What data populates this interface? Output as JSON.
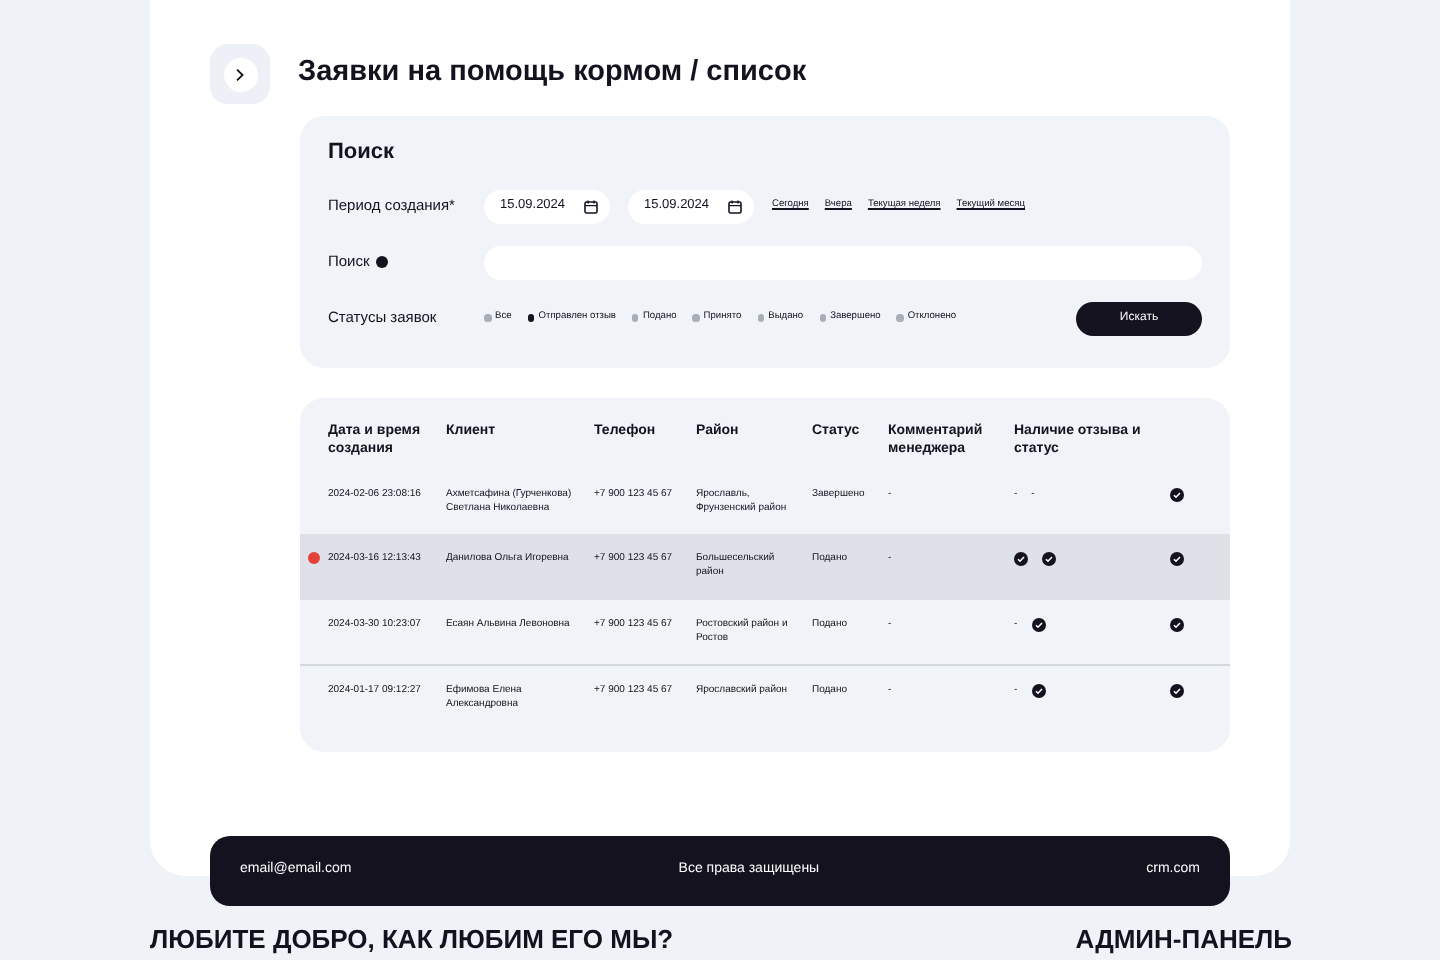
{
  "page": {
    "title": "Заявки на помощь кормом / список"
  },
  "search": {
    "title": "Поиск",
    "period_label": "Период создания*",
    "date_from": "15.09.2024",
    "date_to": "15.09.2024",
    "quick_links": [
      "Сегодня",
      "Вчера",
      "Текущая неделя",
      "Текущий месяц"
    ],
    "search_label": "Поиск",
    "statuses_label": "Статусы заявок",
    "statuses": [
      {
        "label": "Все",
        "selected": false
      },
      {
        "label": "Отправлен отзыв",
        "selected": true
      },
      {
        "label": "Подано",
        "selected": false
      },
      {
        "label": "Принято",
        "selected": false
      },
      {
        "label": "Выдано",
        "selected": false
      },
      {
        "label": "Завершено",
        "selected": false
      },
      {
        "label": "Отклонено",
        "selected": false
      }
    ],
    "button": "Искать"
  },
  "table": {
    "columns": [
      "Дата и время создания",
      "Клиент",
      "Телефон",
      "Район",
      "Статус",
      "Комментарий менеджера",
      "Наличие отзыва и статус"
    ],
    "rows": [
      {
        "selected": false,
        "alert": false,
        "cells": [
          "2024-02-06 23:08:16",
          "Ахметсафина (Гурченкова) Светлана Николаевна",
          "+7 900 123 45 67",
          "Ярославль, Фрунзенский район",
          "Завершено",
          "-"
        ],
        "feedback": [
          {
            "kind": "text",
            "text": "-"
          },
          {
            "kind": "text",
            "text": "-"
          }
        ]
      },
      {
        "selected": true,
        "alert": true,
        "cells": [
          "2024-03-16 12:13:43",
          "Данилова Ольга Игоревна",
          "+7 900 123 45 67",
          "Большесельский район",
          "Подано",
          "-"
        ],
        "feedback": [
          {
            "kind": "check"
          },
          {
            "kind": "check"
          }
        ]
      },
      {
        "selected": false,
        "alert": false,
        "cells": [
          "2024-03-30 10:23:07",
          "Есаян Альвина Левоновна",
          "+7 900 123 45 67",
          "Ростовский район и Ростов",
          "Подано",
          "-"
        ],
        "feedback": [
          {
            "kind": "text",
            "text": "-"
          },
          {
            "kind": "check"
          }
        ]
      },
      {
        "selected": false,
        "alert": false,
        "cells": [
          "2024-01-17 09:12:27",
          "Ефимова Елена Александровна",
          "+7 900 123 45 67",
          "Ярославский район",
          "Подано",
          "-"
        ],
        "feedback": [
          {
            "kind": "text",
            "text": "-"
          },
          {
            "kind": "check"
          }
        ]
      }
    ]
  },
  "footer": {
    "email": "email@email.com",
    "rights": "Все права защищены",
    "site": "crm.com"
  },
  "bottom": {
    "slogan": "ЛЮБИТЕ ДОБРО, КАК ЛЮБИМ ЕГО МЫ?",
    "admin": "АДМИН-ПАНЕЛЬ"
  }
}
